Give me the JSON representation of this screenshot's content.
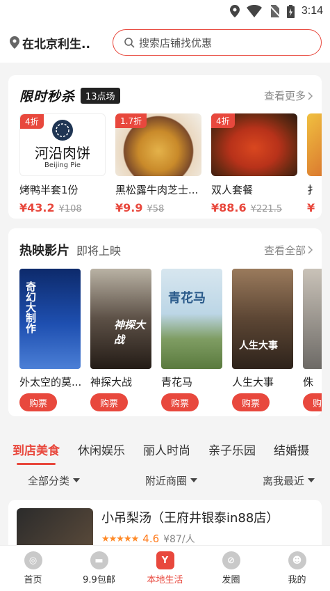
{
  "status": {
    "time": "3:14"
  },
  "header": {
    "location": "在北京利生..",
    "search_placeholder": "搜索店铺找优惠"
  },
  "flash_sale": {
    "title": "限时秒杀",
    "session": "13点场",
    "more": "查看更多",
    "deals": [
      {
        "badge": "4折",
        "name": "烤鸭半套1份",
        "price": "¥43.2",
        "old_price": "¥108",
        "logo_text": "河沿肉饼",
        "logo_sub": "Beijing Pie"
      },
      {
        "badge": "1.7折",
        "name": "黑松露牛肉芝士...",
        "price": "¥9.9",
        "old_price": "¥58"
      },
      {
        "badge": "4折",
        "name": "双人套餐",
        "price": "¥88.6",
        "old_price": "¥221.5"
      },
      {
        "badge": "",
        "name": "扌",
        "price": "¥",
        "old_price": ""
      }
    ]
  },
  "movies": {
    "title": "热映影片",
    "subtitle": "即将上映",
    "more": "查看全部",
    "buy_label": "购票",
    "items": [
      {
        "name": "外太空的莫...",
        "poster_text": "奇幻大制作"
      },
      {
        "name": "神探大战",
        "poster_text": "神探大战"
      },
      {
        "name": "青花马",
        "poster_text": "青花马"
      },
      {
        "name": "人生大事",
        "poster_text": "人生大事"
      },
      {
        "name": "侏",
        "poster_text": ""
      }
    ]
  },
  "category_tabs": [
    "到店美食",
    "休闲娱乐",
    "丽人时尚",
    "亲子乐园",
    "结婚摄"
  ],
  "filters": [
    "全部分类",
    "附近商圈",
    "离我最近"
  ],
  "store": {
    "name": "小吊梨汤（王府井银泰in88店）",
    "rating": "4.6",
    "avg_price": "¥87/人",
    "stars": "★★★★★"
  },
  "bottom_nav": [
    {
      "label": "首页",
      "icon": "home-icon"
    },
    {
      "label": "9.9包邮",
      "icon": "bag-icon"
    },
    {
      "label": "本地生活",
      "icon": "local-life-icon"
    },
    {
      "label": "发圈",
      "icon": "compass-icon"
    },
    {
      "label": "我的",
      "icon": "profile-icon"
    }
  ],
  "colors": {
    "accent": "#e8483d",
    "star": "#ff8a28"
  }
}
